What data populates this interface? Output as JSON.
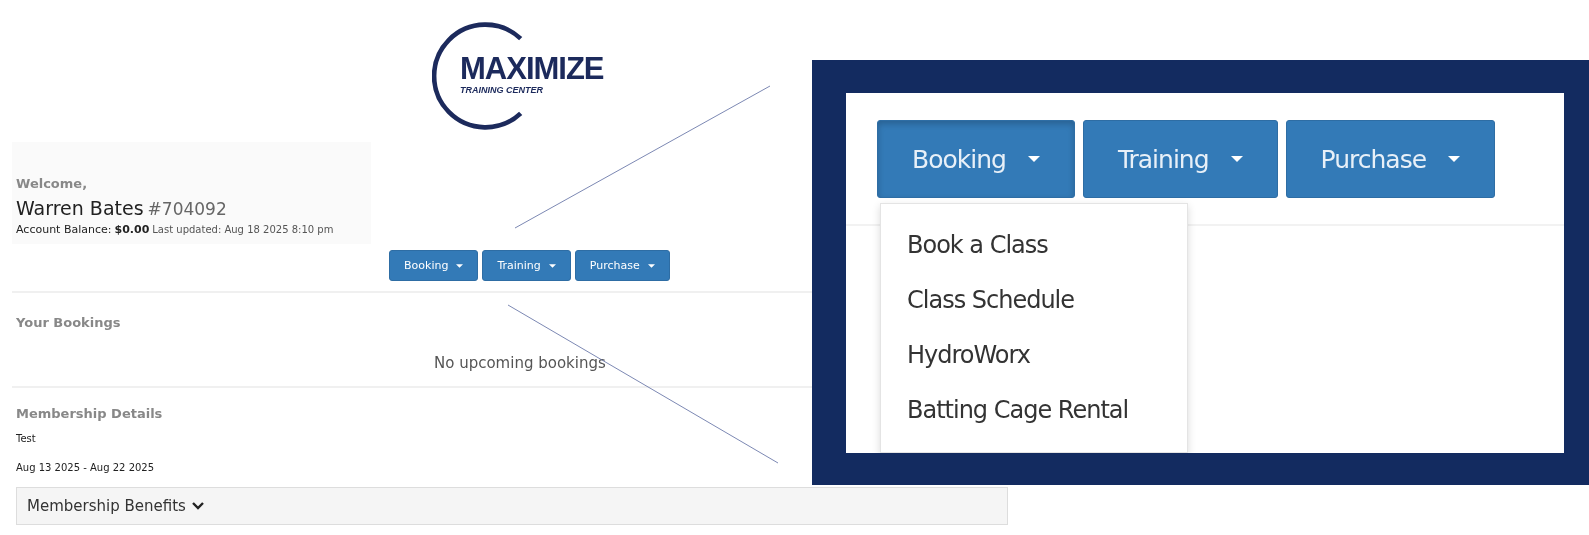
{
  "logo": {
    "name": "MAXIMIZE",
    "tagline": "TRAINING CENTER"
  },
  "account": {
    "greeting": "Welcome,",
    "name": "Warren Bates",
    "member_number": "#704092",
    "balance_label": "Account Balance:",
    "balance": "$0.00",
    "last_updated": "Last updated: Aug 18 2025 8:10 pm"
  },
  "menu_buttons": [
    {
      "label": "Booking"
    },
    {
      "label": "Training"
    },
    {
      "label": "Purchase"
    }
  ],
  "bookings": {
    "title": "Your Bookings",
    "empty_message": "No upcoming bookings"
  },
  "membership": {
    "title": "Membership Details",
    "plan": "Test",
    "dates": "Aug 13 2025 - Aug 22 2025",
    "benefits_toggle": "Membership Benefits"
  },
  "zoom_inset": {
    "menu_buttons": [
      {
        "label": "Booking",
        "expanded": true
      },
      {
        "label": "Training",
        "expanded": false
      },
      {
        "label": "Purchase",
        "expanded": false
      }
    ],
    "dropdown_items": [
      {
        "label": "Book a Class"
      },
      {
        "label": "Class Schedule"
      },
      {
        "label": "HydroWorx"
      },
      {
        "label": "Batting Cage Rental"
      }
    ]
  }
}
